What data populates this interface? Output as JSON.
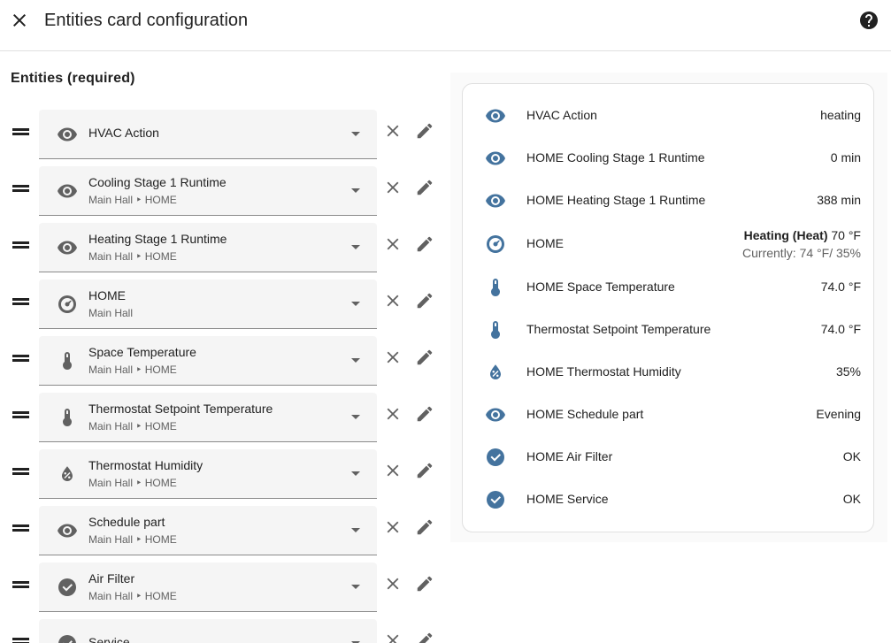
{
  "header": {
    "title": "Entities card configuration"
  },
  "section": {
    "title": "Entities (required)"
  },
  "entities": [
    {
      "name": "HVAC Action",
      "subtitle": "",
      "icon": "eye-icon"
    },
    {
      "name": "Cooling Stage 1 Runtime",
      "subtitle": "Main Hall ‣ HOME",
      "icon": "eye-icon"
    },
    {
      "name": "Heating Stage 1 Runtime",
      "subtitle": "Main Hall ‣ HOME",
      "icon": "eye-icon"
    },
    {
      "name": "HOME",
      "subtitle": "Main Hall",
      "icon": "thermostat-icon"
    },
    {
      "name": "Space Temperature",
      "subtitle": "Main Hall ‣ HOME",
      "icon": "thermometer-icon"
    },
    {
      "name": "Thermostat Setpoint Temperature",
      "subtitle": "Main Hall ‣ HOME",
      "icon": "thermometer-icon"
    },
    {
      "name": "Thermostat Humidity",
      "subtitle": "Main Hall ‣ HOME",
      "icon": "humidity-icon"
    },
    {
      "name": "Schedule part",
      "subtitle": "Main Hall ‣ HOME",
      "icon": "eye-icon"
    },
    {
      "name": "Air Filter",
      "subtitle": "Main Hall ‣ HOME",
      "icon": "check-circle-icon"
    },
    {
      "name": "Service",
      "subtitle": "",
      "icon": "check-circle-icon"
    }
  ],
  "preview": [
    {
      "name": "HVAC Action",
      "value": "heating",
      "icon": "eye-icon"
    },
    {
      "name": "HOME Cooling Stage 1 Runtime",
      "value": "0 min",
      "icon": "eye-icon"
    },
    {
      "name": "HOME Heating Stage 1 Runtime",
      "value": "388 min",
      "icon": "eye-icon"
    },
    {
      "name": "HOME",
      "value_bold": "Heating (Heat)",
      "value_rest": " 70 °F",
      "value_line2": "Currently: 74 °F/ 35%",
      "icon": "thermostat-icon"
    },
    {
      "name": "HOME Space Temperature",
      "value": "74.0 °F",
      "icon": "thermometer-icon"
    },
    {
      "name": "Thermostat Setpoint Temperature",
      "value": "74.0 °F",
      "icon": "thermometer-icon"
    },
    {
      "name": "HOME Thermostat Humidity",
      "value": "35%",
      "icon": "humidity-icon"
    },
    {
      "name": "HOME Schedule part",
      "value": "Evening",
      "icon": "eye-icon"
    },
    {
      "name": "HOME Air Filter",
      "value": "OK",
      "icon": "check-circle-icon"
    },
    {
      "name": "HOME Service",
      "value": "OK",
      "icon": "check-circle-icon"
    }
  ],
  "colors": {
    "state_icon": "#44739e",
    "editor_icon": "#616161",
    "text": "#212121",
    "secondary": "#616161"
  }
}
